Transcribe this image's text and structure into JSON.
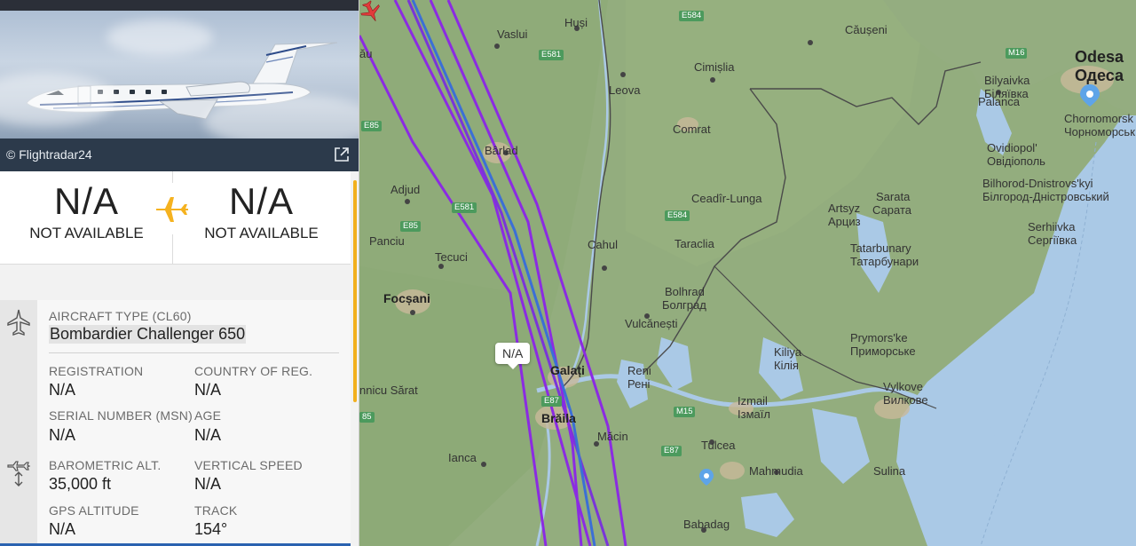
{
  "photo": {
    "credit": "© Flightradar24"
  },
  "route": {
    "origin": {
      "code": "N/A",
      "name": "NOT AVAILABLE"
    },
    "destination": {
      "code": "N/A",
      "name": "NOT AVAILABLE"
    }
  },
  "aircraft": {
    "type_label": "AIRCRAFT TYPE (CL60)",
    "type_value": "Bombardier Challenger 650",
    "registration_label": "REGISTRATION",
    "registration_value": "N/A",
    "country_label": "COUNTRY OF REG.",
    "country_value": "N/A",
    "msn_label": "SERIAL NUMBER (MSN)",
    "msn_value": "N/A",
    "age_label": "AGE",
    "age_value": "N/A"
  },
  "flight_data": {
    "baro_alt_label": "BAROMETRIC ALT.",
    "baro_alt_value": "35,000 ft",
    "vspeed_label": "VERTICAL SPEED",
    "vspeed_value": "N/A",
    "gps_alt_label": "GPS ALTITUDE",
    "gps_alt_value": "N/A",
    "track_label": "TRACK",
    "track_value": "154°"
  },
  "map": {
    "flight_label": "N/A",
    "places": [
      "Vaslui",
      "Huși",
      "Căușeni",
      "Odesa",
      "Одеса",
      "Leova",
      "Cimișlia",
      "Bilyaivka",
      "Біляївка",
      "Palanca",
      "Chornomorsk",
      "Чорноморськ",
      "Comrat",
      "Bârlad",
      "Ovidiopol'",
      "Овідіополь",
      "Bilhorod-Dnistrovs'kyi",
      "Білгород-Дністровський",
      "Ceadîr-Lunga",
      "Adjud",
      "Sarata",
      "Сарата",
      "Artsyz",
      "Арциз",
      "Serhiivka",
      "Сергіївка",
      "Cahul",
      "Taraclia",
      "Panciu",
      "Tatarbunary",
      "Татарбунари",
      "Tecuci",
      "Focșani",
      "Bolhrad",
      "Болград",
      "Vulcănești",
      "Prymors'ke",
      "Приморське",
      "Kiliya",
      "Кілія",
      "Galați",
      "Reni",
      "Рені",
      "Vylkove",
      "Вилкове",
      "nnicu Sărat",
      "Izmail",
      "Ізмаїл",
      "Brăila",
      "Măcin",
      "Tulcea",
      "Ianca",
      "Mahmudia",
      "Sulina",
      "Babadag",
      "ău"
    ],
    "roads": [
      "E584",
      "E581",
      "E85",
      "E581",
      "M16",
      "E85",
      "E584",
      "E87",
      "M15",
      "E87",
      "85"
    ]
  }
}
